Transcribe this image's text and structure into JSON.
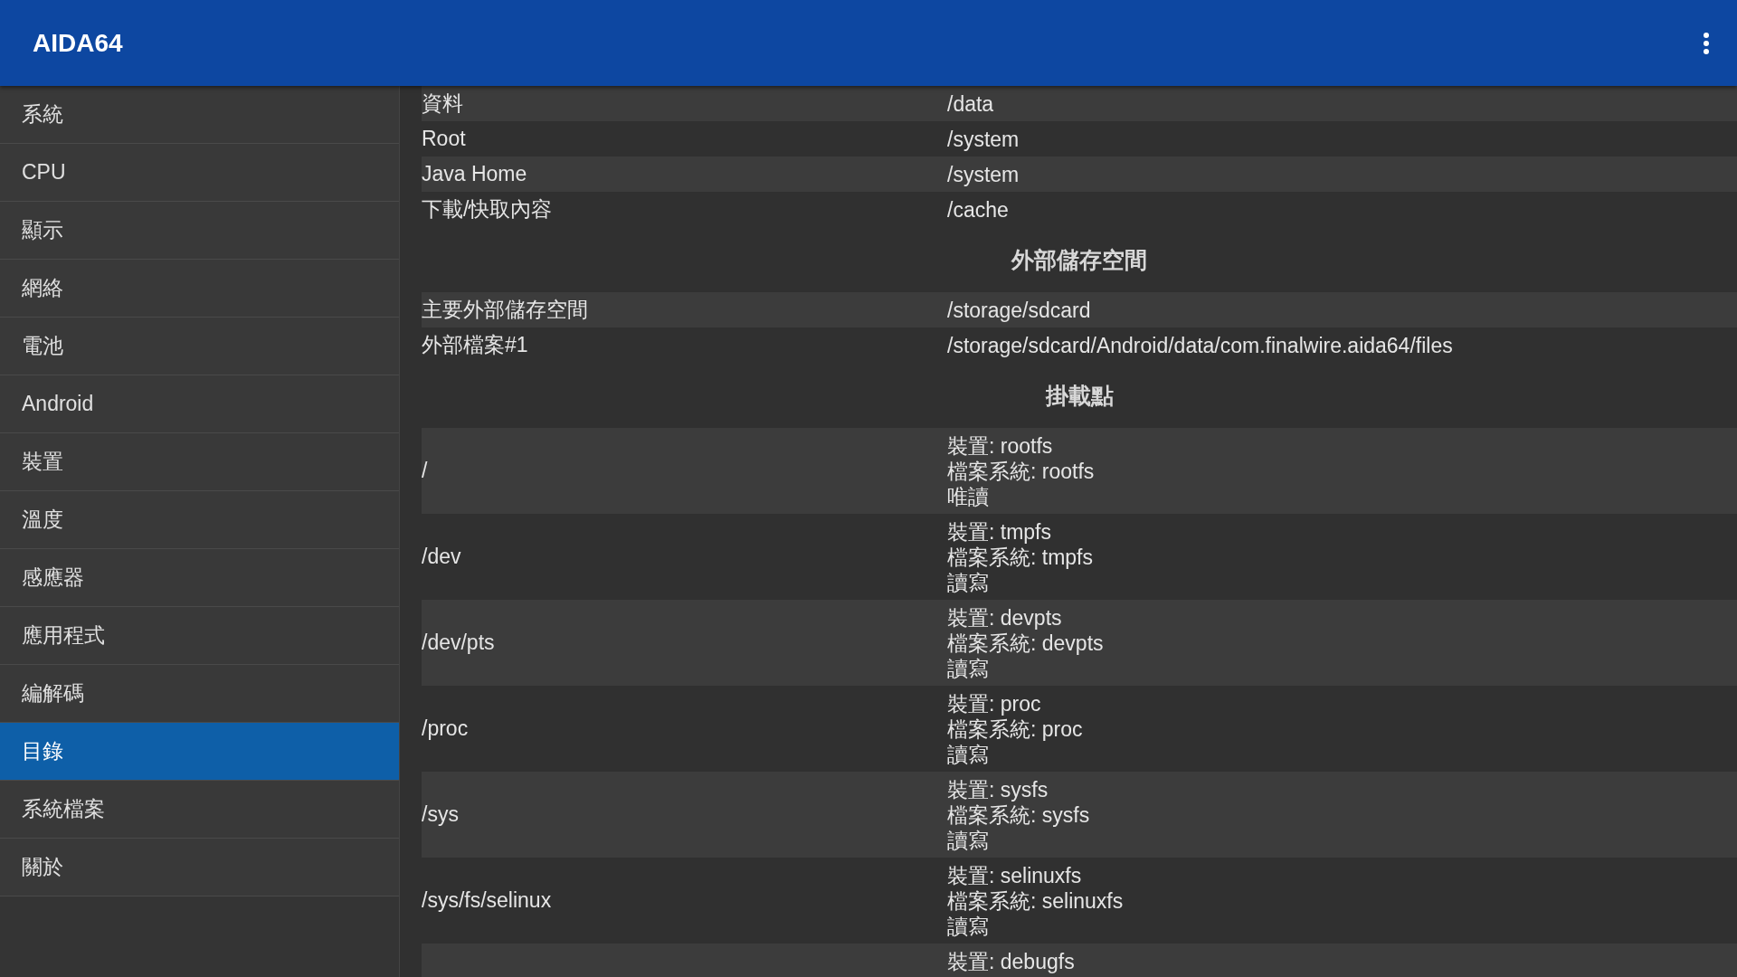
{
  "app_bar": {
    "title": "AIDA64"
  },
  "sidebar": {
    "items": [
      {
        "label": "系統",
        "selected": false
      },
      {
        "label": "CPU",
        "selected": false
      },
      {
        "label": "顯示",
        "selected": false
      },
      {
        "label": "網絡",
        "selected": false
      },
      {
        "label": "電池",
        "selected": false
      },
      {
        "label": "Android",
        "selected": false
      },
      {
        "label": "裝置",
        "selected": false
      },
      {
        "label": "溫度",
        "selected": false
      },
      {
        "label": "感應器",
        "selected": false
      },
      {
        "label": "應用程式",
        "selected": false
      },
      {
        "label": "編解碼",
        "selected": false
      },
      {
        "label": "目錄",
        "selected": true
      },
      {
        "label": "系統檔案",
        "selected": false
      },
      {
        "label": "關於",
        "selected": false
      }
    ]
  },
  "sections": [
    {
      "rows": [
        {
          "label": "資料",
          "lines": [
            "/data"
          ]
        },
        {
          "label": "Root",
          "lines": [
            "/system"
          ]
        },
        {
          "label": "Java Home",
          "lines": [
            "/system"
          ]
        },
        {
          "label": "下載/快取內容",
          "lines": [
            "/cache"
          ]
        }
      ]
    },
    {
      "heading": "外部儲存空間",
      "rows": [
        {
          "label": "主要外部儲存空間",
          "lines": [
            "/storage/sdcard"
          ]
        },
        {
          "label": "外部檔案#1",
          "lines": [
            "/storage/sdcard/Android/data/com.finalwire.aida64/files"
          ]
        }
      ]
    },
    {
      "heading": "掛載點",
      "rows": [
        {
          "label": "/",
          "lines": [
            "裝置: rootfs",
            "檔案系統: rootfs",
            "唯讀"
          ]
        },
        {
          "label": "/dev",
          "lines": [
            "裝置: tmpfs",
            "檔案系統: tmpfs",
            "讀寫"
          ]
        },
        {
          "label": "/dev/pts",
          "lines": [
            "裝置: devpts",
            "檔案系統: devpts",
            "讀寫"
          ]
        },
        {
          "label": "/proc",
          "lines": [
            "裝置: proc",
            "檔案系統: proc",
            "讀寫"
          ]
        },
        {
          "label": "/sys",
          "lines": [
            "裝置: sysfs",
            "檔案系統: sysfs",
            "讀寫"
          ]
        },
        {
          "label": "/sys/fs/selinux",
          "lines": [
            "裝置: selinuxfs",
            "檔案系統: selinuxfs",
            "讀寫"
          ]
        },
        {
          "lines": [
            "裝置: debugfs"
          ]
        }
      ]
    }
  ]
}
